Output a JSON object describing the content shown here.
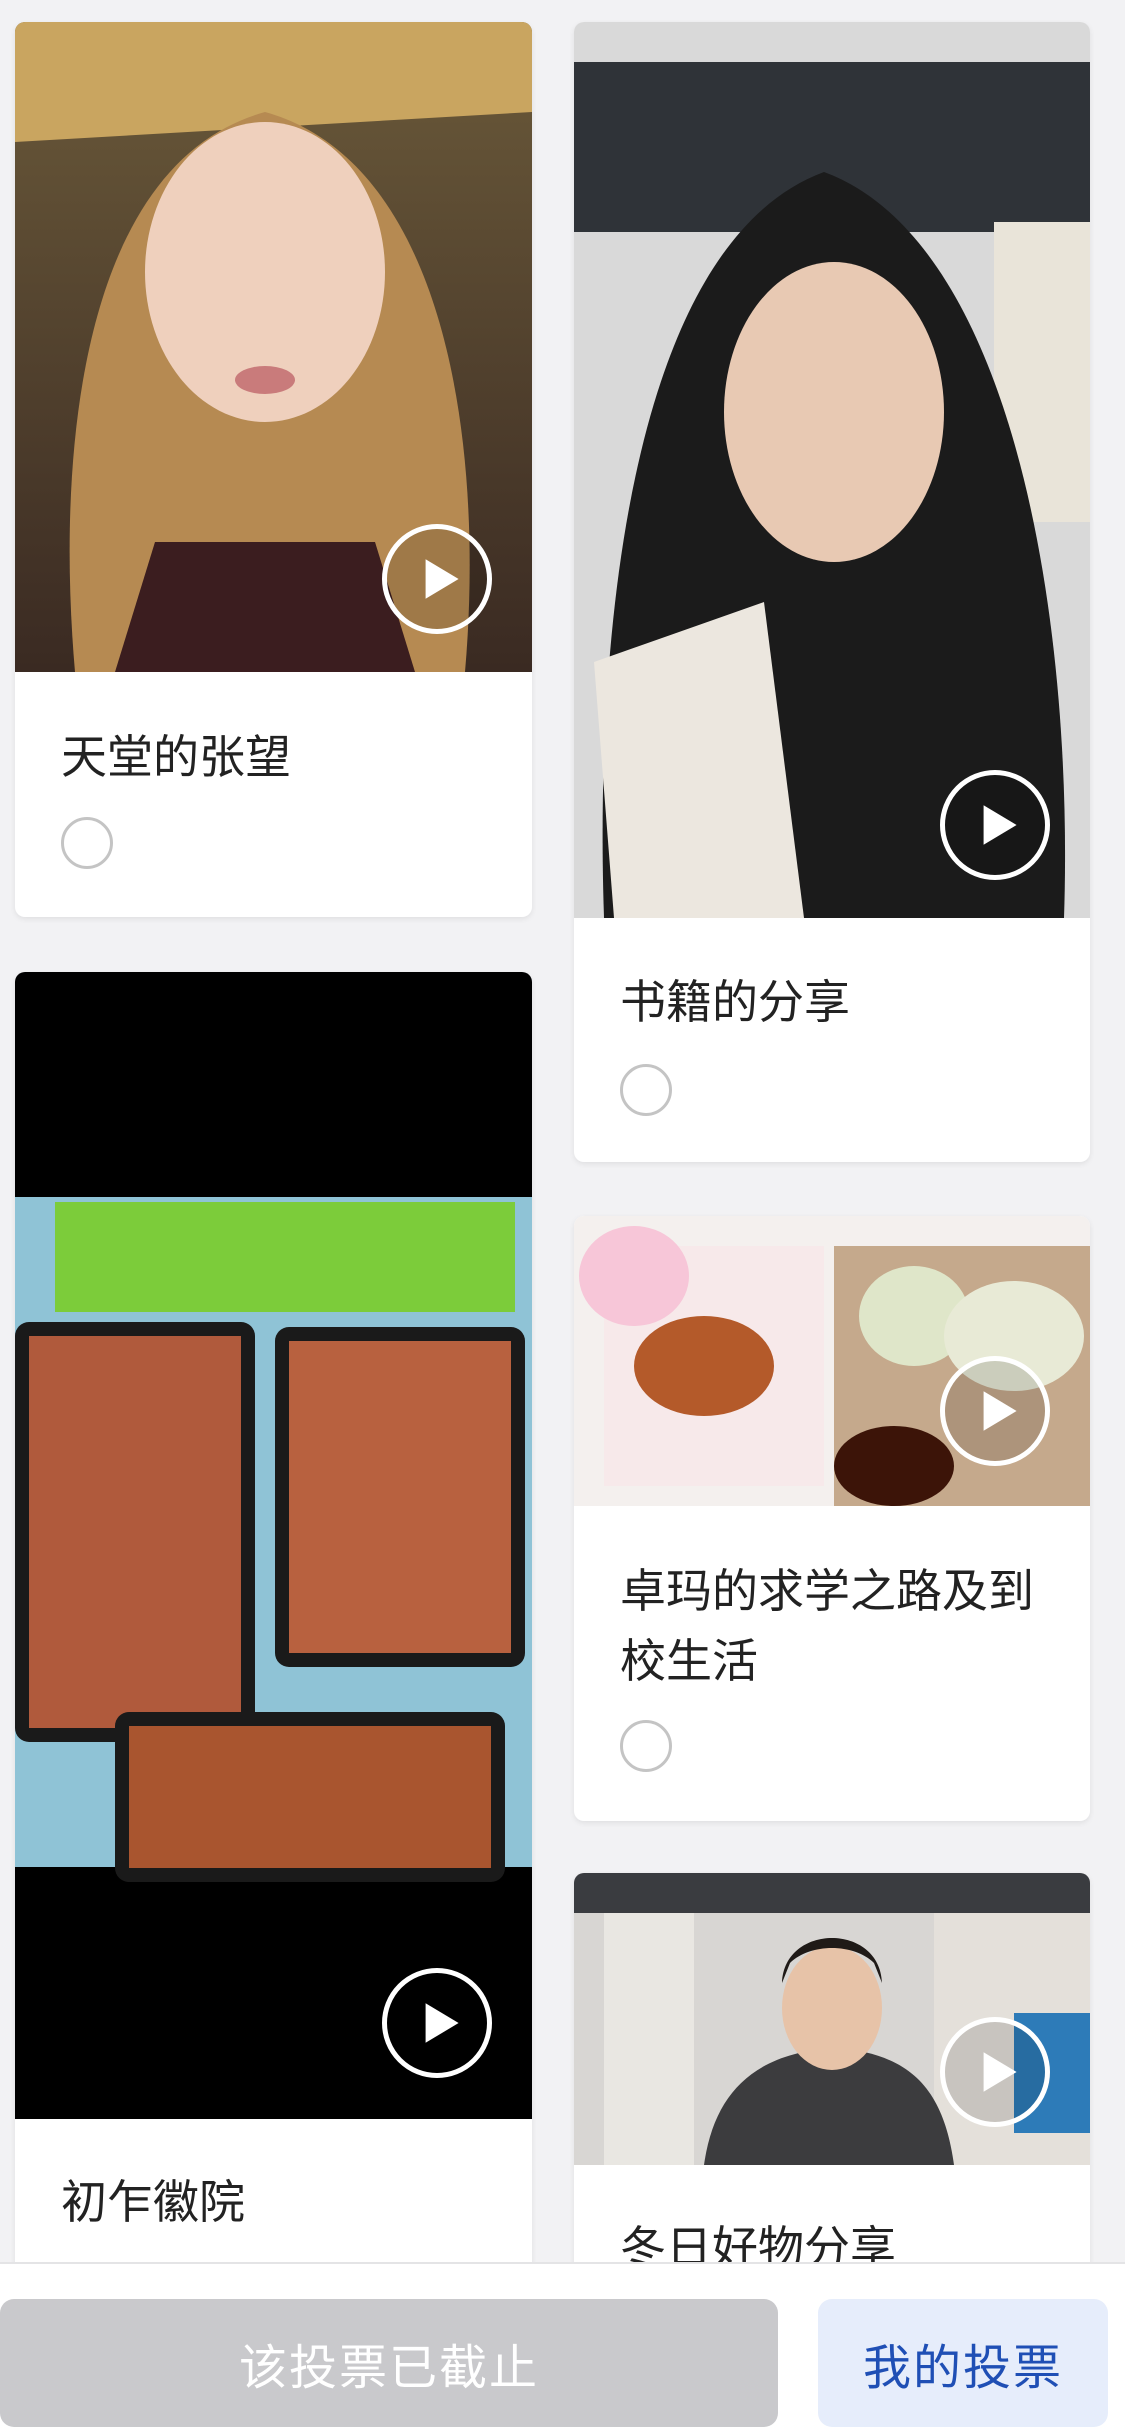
{
  "entries": [
    {
      "title": "天堂的张望",
      "selected": false,
      "thumbnail_icon": "video-thumbnail"
    },
    {
      "title": "书籍的分享",
      "selected": false,
      "thumbnail_icon": "video-thumbnail"
    },
    {
      "title": "初乍徽院",
      "selected": false,
      "thumbnail_icon": "video-thumbnail"
    },
    {
      "title": "卓玛的求学之路及到校生活",
      "selected": false,
      "thumbnail_icon": "video-thumbnail"
    },
    {
      "title": "冬日好物分享",
      "selected": false,
      "thumbnail_icon": "video-thumbnail"
    }
  ],
  "bottom_bar": {
    "closed_label": "该投票已截止",
    "my_votes_label": "我的投票"
  },
  "colors": {
    "page_bg": "#f2f2f4",
    "card_bg": "#ffffff",
    "closed_btn_bg": "#c9c9cc",
    "my_votes_bg": "#e6edfb",
    "my_votes_text": "#1f4fb5"
  }
}
